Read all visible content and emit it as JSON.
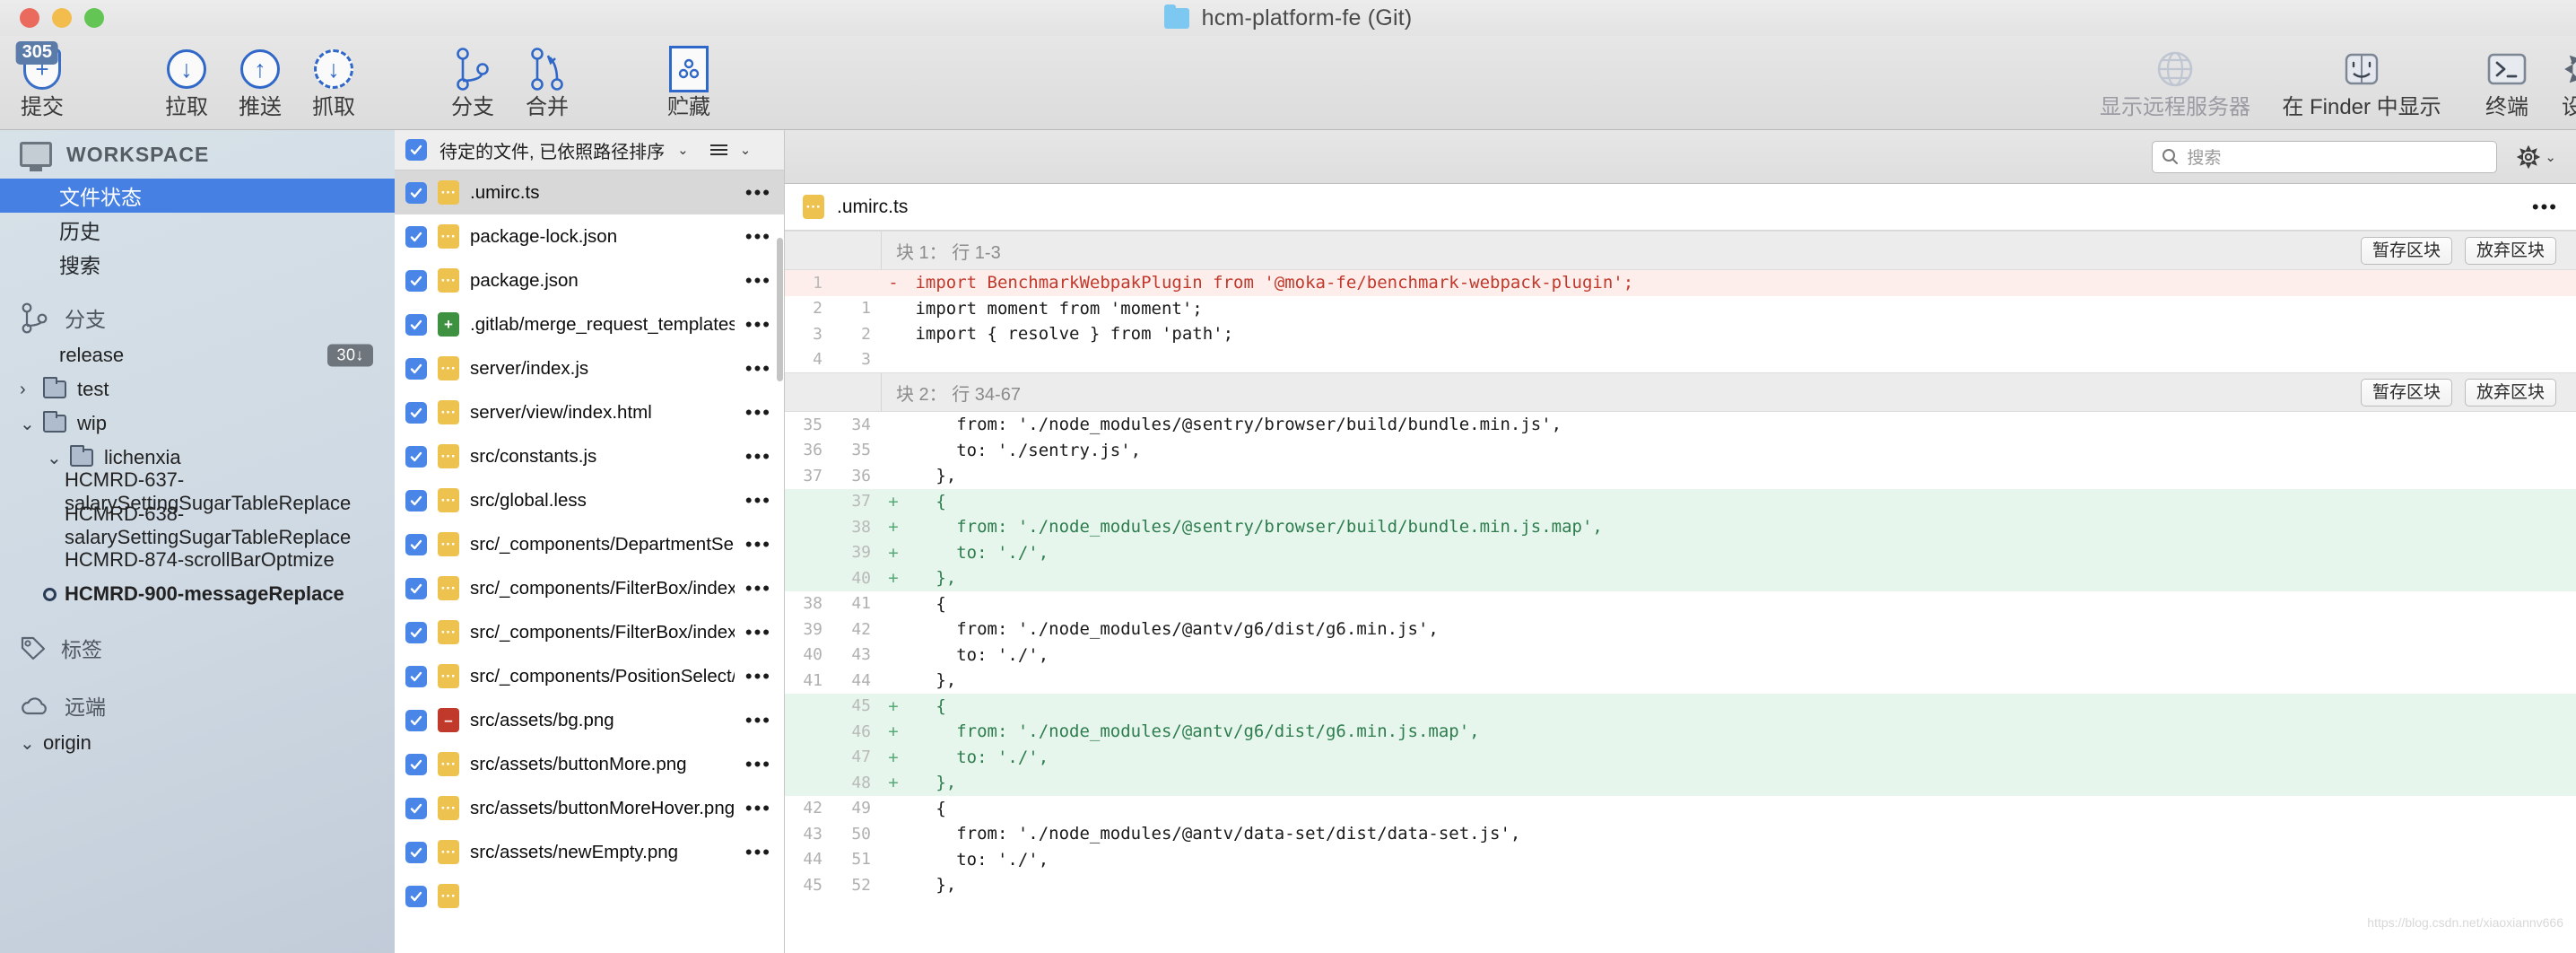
{
  "window": {
    "title": "hcm-platform-fe (Git)",
    "folder_icon": "folder-icon",
    "traffic_lights": [
      "close-button",
      "minimize-button",
      "zoom-button"
    ]
  },
  "toolbar": {
    "items": [
      {
        "label": "提交",
        "icon": "commit-icon",
        "badge": "305",
        "glyph": "+",
        "dimmed": false
      },
      {
        "label": "拉取",
        "icon": "pull-icon",
        "glyph": "↓",
        "dimmed": false
      },
      {
        "label": "推送",
        "icon": "push-icon",
        "glyph": "↑",
        "dimmed": false
      },
      {
        "label": "抓取",
        "icon": "fetch-icon",
        "glyph": "↓",
        "dimmed": false
      },
      {
        "label": "分支",
        "icon": "branch-icon",
        "dimmed": false
      },
      {
        "label": "合并",
        "icon": "merge-icon",
        "dimmed": false
      },
      {
        "label": "贮藏",
        "icon": "stash-icon",
        "dimmed": false
      }
    ],
    "right_items": [
      {
        "label": "显示远程服务器",
        "icon": "globe-icon",
        "dimmed": true
      },
      {
        "label": "在 Finder 中显示",
        "icon": "finder-icon",
        "dimmed": false
      },
      {
        "label": "终端",
        "icon": "terminal-icon",
        "dimmed": false
      },
      {
        "label": "设置",
        "icon": "gear-icon",
        "dimmed": false
      }
    ]
  },
  "sidebar": {
    "workspace_label": "WORKSPACE",
    "nav": [
      {
        "label": "文件状态",
        "active": true
      },
      {
        "label": "历史",
        "active": false
      },
      {
        "label": "搜索",
        "active": false
      }
    ],
    "branches_section": "分支",
    "branches": [
      {
        "label": "release",
        "type": "branch",
        "badge": "30↓",
        "indent": 1
      },
      {
        "label": "test",
        "type": "folder",
        "chevron": "›",
        "indent": 1
      },
      {
        "label": "wip",
        "type": "folder",
        "chevron": "⌄",
        "indent": 1
      },
      {
        "label": "lichenxia",
        "type": "folder",
        "chevron": "⌄",
        "indent": 2
      },
      {
        "label": "HCMRD-637-salarySettingSugarTableReplace",
        "type": "branch",
        "indent": 3
      },
      {
        "label": "HCMRD-638-salarySettingSugarTableReplace",
        "type": "branch",
        "indent": 3
      },
      {
        "label": "HCMRD-874-scrollBarOptmize",
        "type": "branch",
        "indent": 3
      },
      {
        "label": "HCMRD-900-messageReplace",
        "type": "branch",
        "indent": 3,
        "current": true
      }
    ],
    "tags_section": "标签",
    "remotes_section": "远端",
    "remote_items": [
      {
        "label": "origin",
        "chevron": "⌄"
      }
    ]
  },
  "filelist": {
    "header_label": "待定的文件, 已依照路径排序",
    "header_caret": "⌄",
    "view_caret": "⌄",
    "rows": [
      {
        "name": ".umirc.ts",
        "status": "modified",
        "checked": true,
        "selected": true
      },
      {
        "name": "package-lock.json",
        "status": "modified",
        "checked": true
      },
      {
        "name": "package.json",
        "status": "modified",
        "checked": true
      },
      {
        "name": ".gitlab/merge_request_templates/Bug.md",
        "status": "added",
        "checked": true
      },
      {
        "name": "server/index.js",
        "status": "modified",
        "checked": true
      },
      {
        "name": "server/view/index.html",
        "status": "modified",
        "checked": true
      },
      {
        "name": "src/constants.js",
        "status": "modified",
        "checked": true
      },
      {
        "name": "src/global.less",
        "status": "modified",
        "checked": true
      },
      {
        "name": "src/_components/DepartmentSelect/index.js",
        "status": "modified",
        "checked": true
      },
      {
        "name": "src/_components/FilterBox/index.js",
        "status": "modified",
        "checked": true
      },
      {
        "name": "src/_components/FilterBox/index.less",
        "status": "modified",
        "checked": true
      },
      {
        "name": "src/_components/PositionSelect/index.js",
        "status": "modified",
        "checked": true
      },
      {
        "name": "src/assets/bg.png",
        "status": "deleted",
        "checked": true
      },
      {
        "name": "src/assets/buttonMore.png",
        "status": "modified",
        "checked": true
      },
      {
        "name": "src/assets/buttonMoreHover.png",
        "status": "modified",
        "checked": true
      },
      {
        "name": "src/assets/newEmpty.png",
        "status": "modified",
        "checked": true
      },
      {
        "name": "",
        "status": "modified",
        "checked": true
      }
    ]
  },
  "diff": {
    "search_placeholder": "搜索",
    "gear_caret": "⌄",
    "file_name": ".umirc.ts",
    "file_status": "modified",
    "stage_button": "暂存区块",
    "discard_button": "放弃区块",
    "hunks": [
      {
        "title": "块 1： 行 1-3",
        "lines": [
          {
            "old": "1",
            "new": "",
            "type": "del",
            "marker": "-",
            "text": " import BenchmarkWebpakPlugin from '@moka-fe/benchmark-webpack-plugin';"
          },
          {
            "old": "2",
            "new": "1",
            "type": "ctx",
            "marker": "",
            "text": " import moment from 'moment';"
          },
          {
            "old": "3",
            "new": "2",
            "type": "ctx",
            "marker": "",
            "text": " import { resolve } from 'path';"
          },
          {
            "old": "4",
            "new": "3",
            "type": "ctx",
            "marker": "",
            "text": ""
          }
        ]
      },
      {
        "title": "块 2： 行 34-67",
        "lines": [
          {
            "old": "35",
            "new": "34",
            "type": "ctx",
            "marker": "",
            "text": "     from: './node_modules/@sentry/browser/build/bundle.min.js',"
          },
          {
            "old": "36",
            "new": "35",
            "type": "ctx",
            "marker": "",
            "text": "     to: './sentry.js',"
          },
          {
            "old": "37",
            "new": "36",
            "type": "ctx",
            "marker": "",
            "text": "   },"
          },
          {
            "old": "",
            "new": "37",
            "type": "add",
            "marker": "+",
            "text": "   {"
          },
          {
            "old": "",
            "new": "38",
            "type": "add",
            "marker": "+",
            "text": "     from: './node_modules/@sentry/browser/build/bundle.min.js.map',"
          },
          {
            "old": "",
            "new": "39",
            "type": "add",
            "marker": "+",
            "text": "     to: './',"
          },
          {
            "old": "",
            "new": "40",
            "type": "add",
            "marker": "+",
            "text": "   },"
          },
          {
            "old": "38",
            "new": "41",
            "type": "ctx",
            "marker": "",
            "text": "   {"
          },
          {
            "old": "39",
            "new": "42",
            "type": "ctx",
            "marker": "",
            "text": "     from: './node_modules/@antv/g6/dist/g6.min.js',"
          },
          {
            "old": "40",
            "new": "43",
            "type": "ctx",
            "marker": "",
            "text": "     to: './',"
          },
          {
            "old": "41",
            "new": "44",
            "type": "ctx",
            "marker": "",
            "text": "   },"
          },
          {
            "old": "",
            "new": "45",
            "type": "add",
            "marker": "+",
            "text": "   {"
          },
          {
            "old": "",
            "new": "46",
            "type": "add",
            "marker": "+",
            "text": "     from: './node_modules/@antv/g6/dist/g6.min.js.map',"
          },
          {
            "old": "",
            "new": "47",
            "type": "add",
            "marker": "+",
            "text": "     to: './',"
          },
          {
            "old": "",
            "new": "48",
            "type": "add",
            "marker": "+",
            "text": "   },"
          },
          {
            "old": "42",
            "new": "49",
            "type": "ctx",
            "marker": "",
            "text": "   {"
          },
          {
            "old": "43",
            "new": "50",
            "type": "ctx",
            "marker": "",
            "text": "     from: './node_modules/@antv/data-set/dist/data-set.js',"
          },
          {
            "old": "44",
            "new": "51",
            "type": "ctx",
            "marker": "",
            "text": "     to: './',"
          },
          {
            "old": "45",
            "new": "52",
            "type": "ctx",
            "marker": "",
            "text": "   },"
          }
        ]
      }
    ],
    "watermark": "https://blog.csdn.net/xiaoxiannv666"
  },
  "colors": {
    "accent_blue": "#4680e2",
    "checkbox_blue": "#4a85e8",
    "modified_yellow": "#eec24f",
    "added_green": "#3d9141",
    "deleted_red": "#c0392b",
    "diff_add_bg": "#e7f6ec",
    "diff_del_bg": "#fdeeec"
  }
}
